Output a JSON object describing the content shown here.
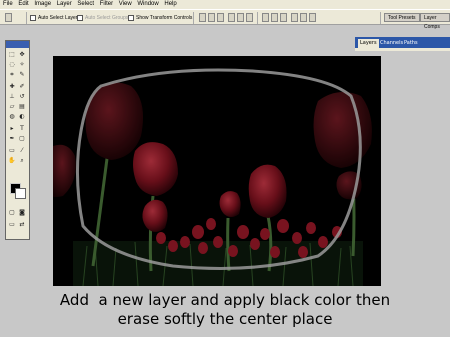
{
  "menu": [
    "File",
    "Edit",
    "Image",
    "Layer",
    "Select",
    "Filter",
    "View",
    "Window",
    "Help"
  ],
  "options": {
    "auto_select_layer": "Auto Select Layer",
    "auto_select_groups": "Auto Select Groups",
    "show_transform_controls": "Show Transform Controls"
  },
  "well": {
    "tool_presets": "Tool Presets",
    "layer_comps": "Layer Comps"
  },
  "panel_tabs": [
    "Layers",
    "Channels",
    "Paths"
  ],
  "caption": {
    "line1": "Add  a new layer and apply black color then",
    "line2": "erase softly the center place"
  },
  "colors": {
    "foreground": "#000000",
    "background": "#ffffff",
    "accent": "#2c57a8"
  }
}
